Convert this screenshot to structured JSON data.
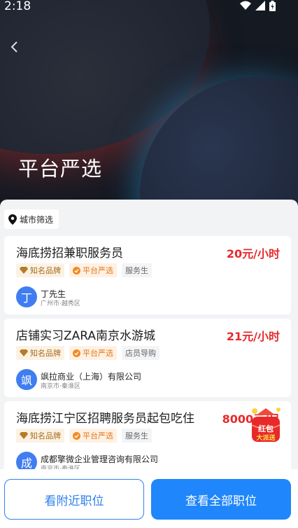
{
  "status_bar": {
    "time": "2:18"
  },
  "page": {
    "title": "平台严选"
  },
  "filter": {
    "city_label": "城市筛选"
  },
  "jobs": [
    {
      "title": "海底捞招兼职服务员",
      "salary": "20元/小时",
      "tags": [
        "知名品牌",
        "平台严选",
        "服务生"
      ],
      "avatar_char": "丁",
      "company": "丁先生",
      "location": "广州市·越秀区"
    },
    {
      "title": "店铺实习ZARA南京水游城",
      "salary": "21元/小时",
      "tags": [
        "知名品牌",
        "平台严选",
        "店员导购"
      ],
      "avatar_char": "飒",
      "company": "飒拉商业（上海）有限公司",
      "location": "南京市·秦淮区"
    },
    {
      "title": "海底捞江宁区招聘服务员起包吃住",
      "salary": "8000元/月",
      "tags": [
        "知名品牌",
        "平台严选",
        "服务生"
      ],
      "avatar_char": "成",
      "company": "成都擎微企业管理咨询有限公司",
      "location": "南京市·秦淮区",
      "badge": {
        "line1": "红包",
        "line2": "大派送"
      }
    }
  ],
  "buttons": {
    "nearby": "看附近职位",
    "all": "查看全部职位"
  },
  "colors": {
    "accent": "#1f86fb",
    "salary": "#e8292a",
    "avatar": "#3f7df1"
  }
}
